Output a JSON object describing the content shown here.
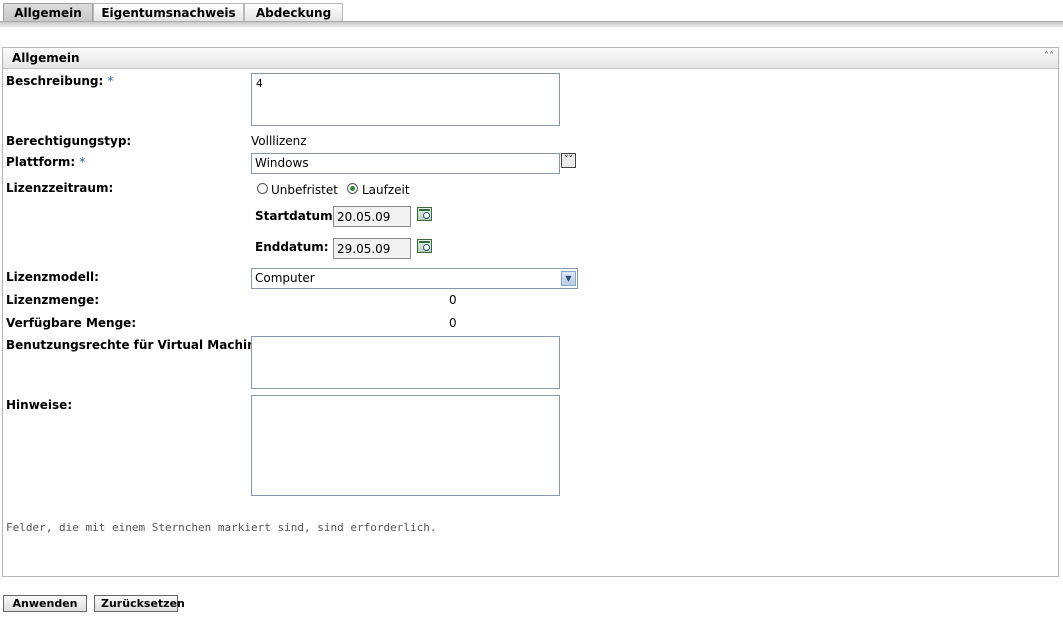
{
  "tabs": [
    {
      "label": "Allgemein",
      "active": true
    },
    {
      "label": "Eigentumsnachweis",
      "active": false
    },
    {
      "label": "Abdeckung",
      "active": false
    }
  ],
  "panel": {
    "title": "Allgemein",
    "collapse_icon": "double-chevron-up-icon"
  },
  "form": {
    "beschreibung": {
      "label": "Beschreibung:",
      "required_mark": "*",
      "value": "4"
    },
    "berechtigungstyp": {
      "label": "Berechtigungstyp:",
      "value": "Volllizenz"
    },
    "plattform": {
      "label": "Plattform:",
      "required_mark": "*",
      "value": "Windows"
    },
    "lizenzzeitraum": {
      "label": "Lizenzzeitraum:",
      "options": [
        "Unbefristet",
        "Laufzeit"
      ],
      "selected": "Laufzeit"
    },
    "startdatum": {
      "label": "Startdatum:",
      "value": "20.05.09"
    },
    "enddatum": {
      "label": "Enddatum:",
      "value": "29.05.09"
    },
    "lizenzmodell": {
      "label": "Lizenzmodell:",
      "value": "Computer"
    },
    "lizenzmenge": {
      "label": "Lizenzmenge:",
      "value": "0"
    },
    "verfuegbare_menge": {
      "label": "Verfügbare Menge:",
      "value": "0"
    },
    "vm_rechte": {
      "label": "Benutzungsrechte für Virtual Machine:",
      "value": ""
    },
    "hinweise": {
      "label": "Hinweise:",
      "value": ""
    }
  },
  "note": "Felder, die mit einem Sternchen markiert sind, sind erforderlich.",
  "buttons": {
    "apply": "Anwenden",
    "reset": "Zurücksetzen"
  },
  "colors": {
    "required_mark": "#2a5db0",
    "radio_selected": "#2a8a3a"
  }
}
